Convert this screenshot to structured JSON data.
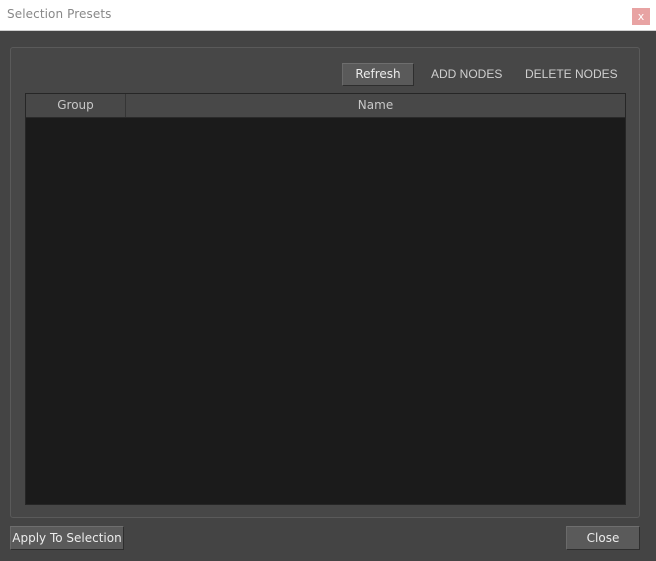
{
  "window": {
    "title": "Selection Presets",
    "close_glyph": "x"
  },
  "toolbar": {
    "refresh_label": "Refresh",
    "add_nodes_label": "ADD NODES",
    "delete_nodes_label": "DELETE NODES"
  },
  "tree": {
    "columns": [
      "Group",
      "Name"
    ],
    "rows": []
  },
  "footer": {
    "apply_label": "Apply To Selection",
    "close_label": "Close"
  },
  "colors": {
    "background": "#444444",
    "tree_background": "#1b1b1b",
    "title_close_button": "#e8a3a3"
  },
  "icons": {
    "title_close": "close-icon"
  }
}
